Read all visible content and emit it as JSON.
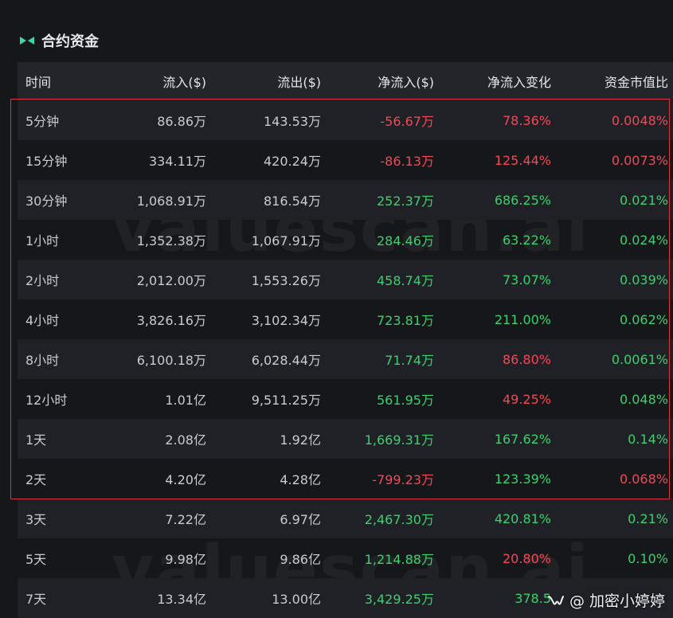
{
  "header": {
    "title": "合约资金",
    "icon": "infinity-icon"
  },
  "columns": [
    "时间",
    "流入($)",
    "流出($)",
    "净流入($)",
    "净流入变化",
    "资金市值比"
  ],
  "rows": [
    {
      "time": "5分钟",
      "inflow": "86.86万",
      "outflow": "143.53万",
      "net": "-56.67万",
      "change": "78.36%",
      "ratio": "0.0048%",
      "net_sign": "neg",
      "change_sign": "neg",
      "ratio_sign": "neg"
    },
    {
      "time": "15分钟",
      "inflow": "334.11万",
      "outflow": "420.24万",
      "net": "-86.13万",
      "change": "125.44%",
      "ratio": "0.0073%",
      "net_sign": "neg",
      "change_sign": "neg",
      "ratio_sign": "neg"
    },
    {
      "time": "30分钟",
      "inflow": "1,068.91万",
      "outflow": "816.54万",
      "net": "252.37万",
      "change": "686.25%",
      "ratio": "0.021%",
      "net_sign": "pos",
      "change_sign": "pos",
      "ratio_sign": "pos"
    },
    {
      "time": "1小时",
      "inflow": "1,352.38万",
      "outflow": "1,067.91万",
      "net": "284.46万",
      "change": "63.22%",
      "ratio": "0.024%",
      "net_sign": "pos",
      "change_sign": "pos",
      "ratio_sign": "pos"
    },
    {
      "time": "2小时",
      "inflow": "2,012.00万",
      "outflow": "1,553.26万",
      "net": "458.74万",
      "change": "73.07%",
      "ratio": "0.039%",
      "net_sign": "pos",
      "change_sign": "pos",
      "ratio_sign": "pos"
    },
    {
      "time": "4小时",
      "inflow": "3,826.16万",
      "outflow": "3,102.34万",
      "net": "723.81万",
      "change": "211.00%",
      "ratio": "0.062%",
      "net_sign": "pos",
      "change_sign": "pos",
      "ratio_sign": "pos"
    },
    {
      "time": "8小时",
      "inflow": "6,100.18万",
      "outflow": "6,028.44万",
      "net": "71.74万",
      "change": "86.80%",
      "ratio": "0.0061%",
      "net_sign": "pos",
      "change_sign": "neg",
      "ratio_sign": "pos"
    },
    {
      "time": "12小时",
      "inflow": "1.01亿",
      "outflow": "9,511.25万",
      "net": "561.95万",
      "change": "49.25%",
      "ratio": "0.048%",
      "net_sign": "pos",
      "change_sign": "neg",
      "ratio_sign": "pos"
    },
    {
      "time": "1天",
      "inflow": "2.08亿",
      "outflow": "1.92亿",
      "net": "1,669.31万",
      "change": "167.62%",
      "ratio": "0.14%",
      "net_sign": "pos",
      "change_sign": "pos",
      "ratio_sign": "pos"
    },
    {
      "time": "2天",
      "inflow": "4.20亿",
      "outflow": "4.28亿",
      "net": "-799.23万",
      "change": "123.39%",
      "ratio": "0.068%",
      "net_sign": "neg",
      "change_sign": "pos",
      "ratio_sign": "neg"
    },
    {
      "time": "3天",
      "inflow": "7.22亿",
      "outflow": "6.97亿",
      "net": "2,467.30万",
      "change": "420.81%",
      "ratio": "0.21%",
      "net_sign": "pos",
      "change_sign": "pos",
      "ratio_sign": "pos"
    },
    {
      "time": "5天",
      "inflow": "9.98亿",
      "outflow": "9.86亿",
      "net": "1,214.88万",
      "change": "20.80%",
      "ratio": "0.10%",
      "net_sign": "pos",
      "change_sign": "neg",
      "ratio_sign": "pos"
    },
    {
      "time": "7天",
      "inflow": "13.34亿",
      "outflow": "13.00亿",
      "net": "3,429.25万",
      "change": "378.5",
      "ratio": "",
      "net_sign": "pos",
      "change_sign": "pos",
      "ratio_sign": "pos"
    }
  ],
  "watermark": "valuescan.ai",
  "credit": {
    "text": "@ 加密小婷婷",
    "icon": "wechat-channel-icon"
  },
  "colors": {
    "positive": "#3fcf6e",
    "negative": "#f04a57",
    "highlight_border": "#d8363f"
  }
}
